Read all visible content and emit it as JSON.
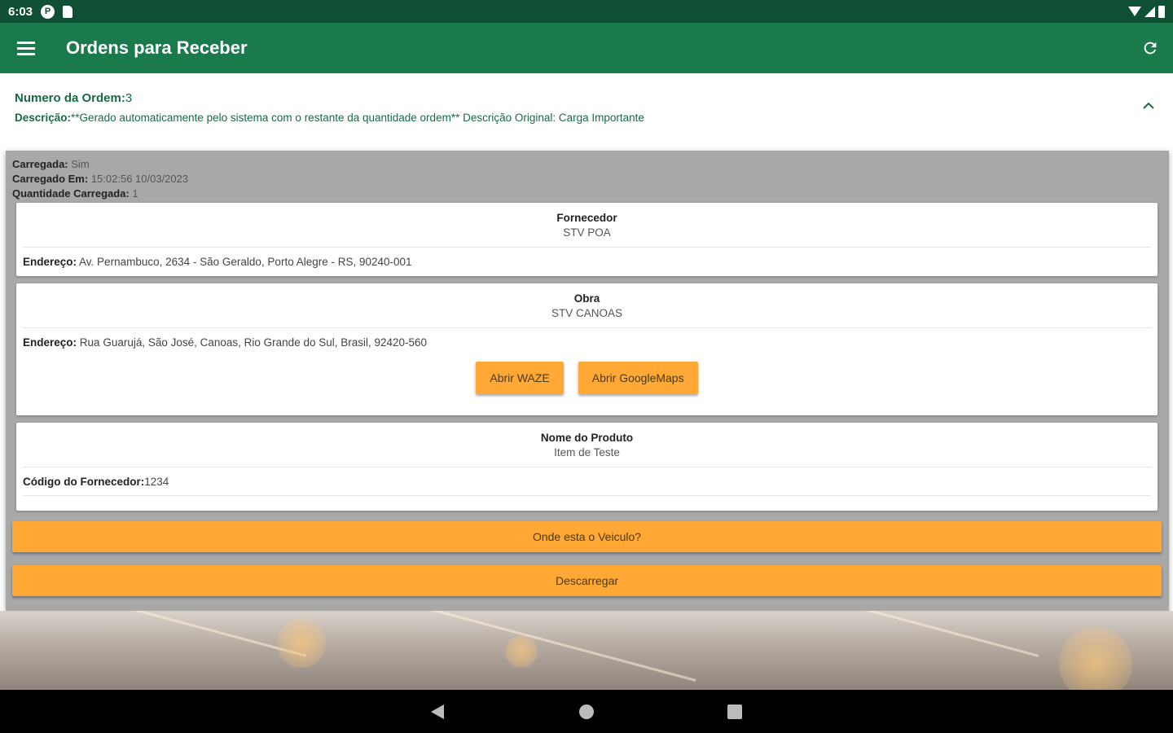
{
  "status_bar": {
    "time": "6:03",
    "p_icon_letter": "P"
  },
  "app_bar": {
    "title": "Ordens para Receber"
  },
  "order": {
    "number_label": "Numero da Ordem:",
    "number_value": "3",
    "description_label": "Descrição:",
    "description_value": "**Gerado automaticamente pelo sistema com o restante da quantidade ordem** Descrição Original: Carga Importante"
  },
  "load_info": {
    "loaded_label": "Carregada:",
    "loaded_value": "Sim",
    "loaded_at_label": "Carregado Em:",
    "loaded_at_value": "15:02:56 10/03/2023",
    "quantity_label": "Quantidade Carregada:",
    "quantity_value": "1"
  },
  "supplier_card": {
    "title": "Fornecedor",
    "name": "STV POA",
    "address_label": "Endereço:",
    "address_value": "Av. Pernambuco, 2634 - São Geraldo, Porto Alegre - RS, 90240-001"
  },
  "site_card": {
    "title": "Obra",
    "name": "STV CANOAS",
    "address_label": "Endereço:",
    "address_value": "Rua Guarujá, São José, Canoas, Rio Grande do Sul, Brasil, 92420-560",
    "waze_button": "Abrir WAZE",
    "gmaps_button": "Abrir GoogleMaps"
  },
  "product_card": {
    "title": "Nome do Produto",
    "name": "Item de Teste",
    "supplier_code_label": "Código do Fornecedor:",
    "supplier_code_value": "1234"
  },
  "actions": {
    "where_vehicle": "Onde esta o Veiculo?",
    "unload": "Descarregar"
  },
  "colors": {
    "status_bar": "#0f4f34",
    "app_bar": "#1a7a4c",
    "accent_orange": "#ffa836",
    "panel_gray": "#a8a8a8"
  }
}
